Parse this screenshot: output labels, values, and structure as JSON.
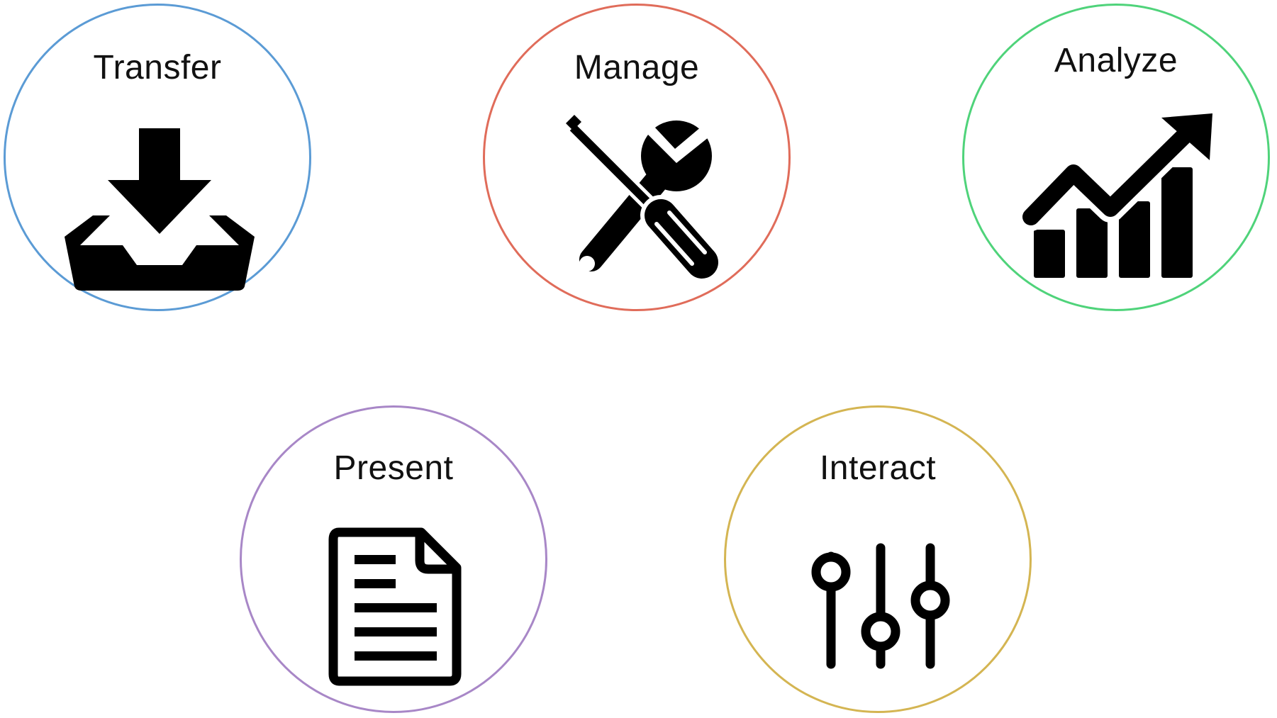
{
  "nodes": [
    {
      "id": "transfer",
      "label": "Transfer",
      "color": "#5b9bd5",
      "icon": "download-tray-icon"
    },
    {
      "id": "manage",
      "label": "Manage",
      "color": "#e06c5a",
      "icon": "wrench-screwdriver-icon"
    },
    {
      "id": "analyze",
      "label": "Analyze",
      "color": "#4fd37a",
      "icon": "trend-chart-icon"
    },
    {
      "id": "present",
      "label": "Present",
      "color": "#a887c7",
      "icon": "document-icon"
    },
    {
      "id": "interact",
      "label": "Interact",
      "color": "#d4b552",
      "icon": "sliders-icon"
    }
  ]
}
